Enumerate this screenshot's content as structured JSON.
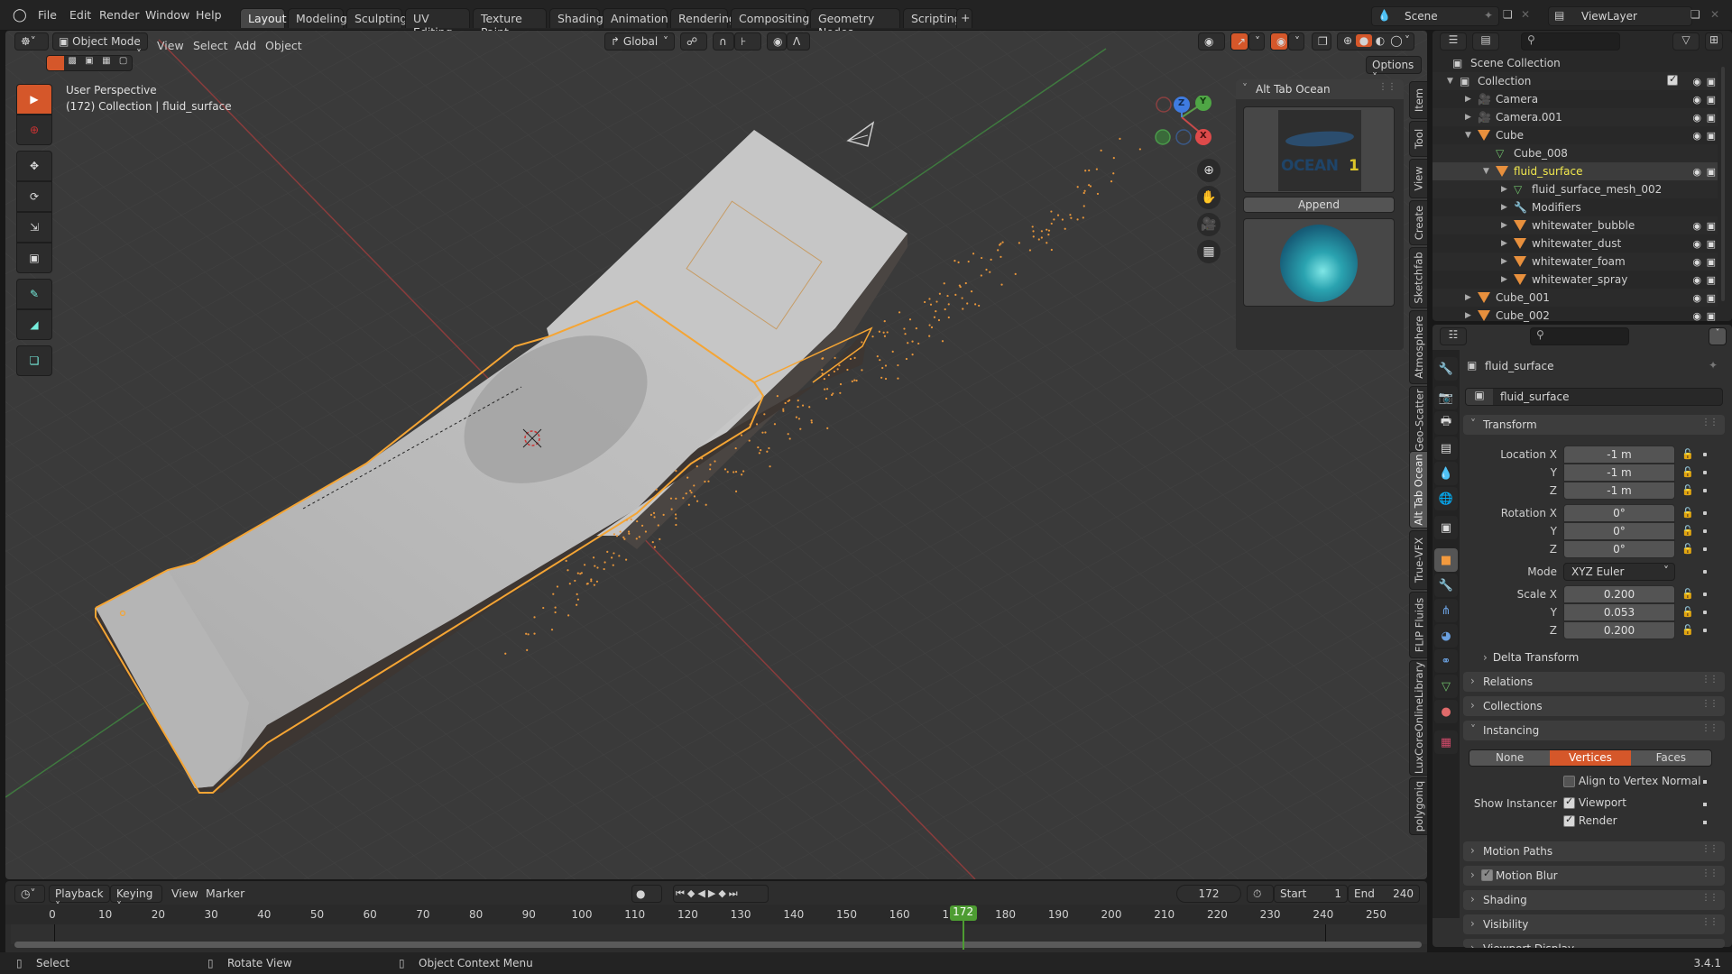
{
  "app": {
    "version": "3.4.1"
  },
  "topbar": {
    "menus": [
      "File",
      "Edit",
      "Render",
      "Window",
      "Help"
    ],
    "workspaces": [
      {
        "label": "Layout",
        "active": true
      },
      {
        "label": "Modeling"
      },
      {
        "label": "Sculpting"
      },
      {
        "label": "UV Editing"
      },
      {
        "label": "Texture Paint"
      },
      {
        "label": "Shading"
      },
      {
        "label": "Animation"
      },
      {
        "label": "Rendering"
      },
      {
        "label": "Compositing"
      },
      {
        "label": "Geometry Nodes"
      },
      {
        "label": "Scripting"
      }
    ],
    "add_workspace": "+",
    "scene": "Scene",
    "view_layer": "ViewLayer"
  },
  "viewport": {
    "mode": "Object Mode",
    "menus": [
      "View",
      "Select",
      "Add",
      "Object"
    ],
    "orientation": "Global",
    "options_label": "Options",
    "overlay_text": {
      "line1": "User Perspective",
      "line2": "(172) Collection | fluid_surface"
    },
    "gizmo_axes": {
      "x": "X",
      "y": "Y",
      "z": "Z"
    },
    "n_tabs": [
      "Item",
      "Tool",
      "View",
      "Create",
      "Sketchfab",
      "Atmosphere",
      "Geo-Scatter",
      "Alt Tab Ocean",
      "True-VFX",
      "FLIP Fluids",
      "LuxCoreOnlineLibrary",
      "polygoniq"
    ],
    "active_n_tab": "Alt Tab Ocean",
    "addon_panel": {
      "title": "Alt Tab Ocean",
      "preview_label": "OCEAN",
      "preview_number": "1",
      "append_label": "Append"
    }
  },
  "outliner": {
    "root": "Scene Collection",
    "rows": [
      {
        "label": "Collection",
        "depth": 0,
        "type": "collection",
        "expanded": true
      },
      {
        "label": "Camera",
        "depth": 1,
        "type": "camera"
      },
      {
        "label": "Camera.001",
        "depth": 1,
        "type": "camera"
      },
      {
        "label": "Cube",
        "depth": 1,
        "type": "mesh",
        "expanded": true
      },
      {
        "label": "Cube_008",
        "depth": 2,
        "type": "meshdata"
      },
      {
        "label": "fluid_surface",
        "depth": 2,
        "type": "mesh",
        "expanded": true,
        "selected": true
      },
      {
        "label": "fluid_surface_mesh_002",
        "depth": 3,
        "type": "meshdata"
      },
      {
        "label": "Modifiers",
        "depth": 3,
        "type": "modifiers"
      },
      {
        "label": "whitewater_bubble",
        "depth": 3,
        "type": "mesh"
      },
      {
        "label": "whitewater_dust",
        "depth": 3,
        "type": "mesh"
      },
      {
        "label": "whitewater_foam",
        "depth": 3,
        "type": "mesh"
      },
      {
        "label": "whitewater_spray",
        "depth": 3,
        "type": "mesh"
      },
      {
        "label": "Cube_001",
        "depth": 1,
        "type": "mesh"
      },
      {
        "label": "Cube_002",
        "depth": 1,
        "type": "mesh"
      }
    ]
  },
  "properties": {
    "object_name": "fluid_surface",
    "datablock_name": "fluid_surface",
    "transform": {
      "title": "Transform",
      "location": {
        "label": "Location X",
        "x": "-1 m",
        "y": "-1 m",
        "z": "-1 m"
      },
      "rotation": {
        "label": "Rotation X",
        "x": "0°",
        "y": "0°",
        "z": "0°"
      },
      "mode_label": "Mode",
      "mode_value": "XYZ Euler",
      "scale": {
        "label": "Scale X",
        "x": "0.200",
        "y": "0.053",
        "z": "0.200"
      },
      "y_label": "Y",
      "z_label": "Z"
    },
    "delta_transform": "Delta Transform",
    "panels_collapsed": [
      "Relations",
      "Collections"
    ],
    "instancing": {
      "title": "Instancing",
      "options": [
        "None",
        "Vertices",
        "Faces"
      ],
      "active": "Vertices",
      "align_label": "Align to Vertex Normal",
      "align_checked": false,
      "show_instancer_label": "Show Instancer",
      "viewport_label": "Viewport",
      "viewport_checked": true,
      "render_label": "Render",
      "render_checked": true
    },
    "panels_after": [
      "Motion Paths",
      "Motion Blur",
      "Shading",
      "Visibility",
      "Viewport Display"
    ],
    "motion_blur_checked": true
  },
  "timeline": {
    "menus": [
      "Playback",
      "Keying",
      "View",
      "Marker"
    ],
    "current_frame": "172",
    "start_label": "Start",
    "start": "1",
    "end_label": "End",
    "end": "240",
    "ticks": [
      0,
      10,
      20,
      30,
      40,
      50,
      60,
      70,
      80,
      90,
      100,
      110,
      120,
      130,
      140,
      150,
      160,
      170,
      180,
      190,
      200,
      210,
      220,
      230,
      240,
      250
    ]
  },
  "statusbar": {
    "items": [
      "Select",
      "Rotate View",
      "Object Context Menu"
    ],
    "version": "3.4.1"
  },
  "colors": {
    "accent": "#d5572a",
    "selection": "#f5a534",
    "active_text": "#f2e94e",
    "timeline_marker": "#4d9c32"
  }
}
